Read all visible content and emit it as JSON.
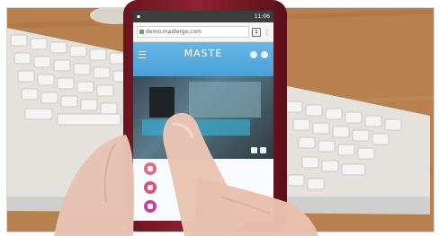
{
  "phone": {
    "status_bar": {
      "time": "11:06",
      "icons": [
        "notification-icon",
        "alarm-icon",
        "wifi-icon",
        "signal-icon",
        "battery-icon"
      ]
    },
    "browser": {
      "url": "demo.mastergo.com",
      "tab_count": "1",
      "menu_icon": "menu-dots-icon"
    },
    "website": {
      "title": "MASTE",
      "subtitle": "",
      "header_icons": [
        "hamburger-menu-icon",
        "user-icon",
        "settings-icon"
      ],
      "social_icons": [
        "facebook-icon",
        "twitter-icon"
      ],
      "floating_buttons": [
        "profile-button",
        "chat-button",
        "share-button"
      ]
    }
  },
  "scene": {
    "desk_color": "#b57a4a",
    "keyboard_color": "#e8e8e8",
    "phone_case_color": "#8f2231"
  }
}
